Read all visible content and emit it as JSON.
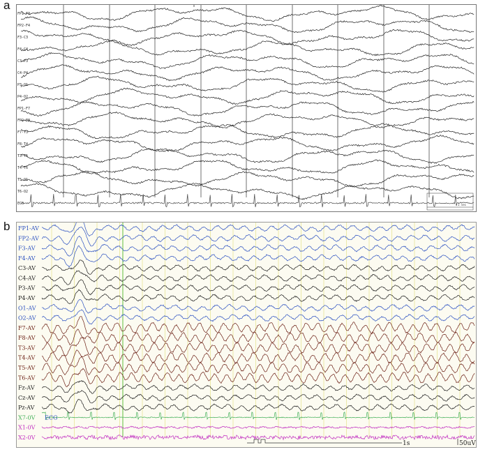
{
  "panels": {
    "a": {
      "letter": "a",
      "leads": [
        "FP1-F3",
        "FP2-F4",
        "F3-C3",
        "F4-C4",
        "C3-P3",
        "C4-P4",
        "P3-O1",
        "P4-O2",
        "FP1-F7",
        "FP2-F8",
        "F7-T3",
        "F8-T4",
        "T3-T5",
        "T4-T6",
        "T5-O1",
        "T6-O2",
        "ECG"
      ],
      "scale_label": "1 sec",
      "colors": {
        "trace": "#222222",
        "ecg": "#444444",
        "grid": "#333333"
      }
    },
    "b": {
      "letter": "b",
      "leads": [
        "FP1-AV",
        "FP2-AV",
        "F3-AV",
        "F4-AV",
        "C3-AV",
        "C4-AV",
        "P3-AV",
        "P4-AV",
        "O1-AV",
        "O2-AV",
        "F7-AV",
        "F8-AV",
        "T3-AV",
        "T4-AV",
        "T5-AV",
        "T6-AV",
        "Fz-AV",
        "Cz-AV",
        "Pz-AV",
        "X7-0V",
        "X1-0V",
        "X2-0V"
      ],
      "ecg_label": "ECG",
      "time_scale": "1s",
      "amplitude_scale": "50uV",
      "colors": {
        "blue": "#2a4fc0",
        "black": "#1a1a1a",
        "brown": "#6b1f14",
        "green": "#3fae55",
        "magenta": "#c02cc0",
        "grid": "#e6e28a",
        "green_marker": "#5fbf3a"
      }
    }
  }
}
